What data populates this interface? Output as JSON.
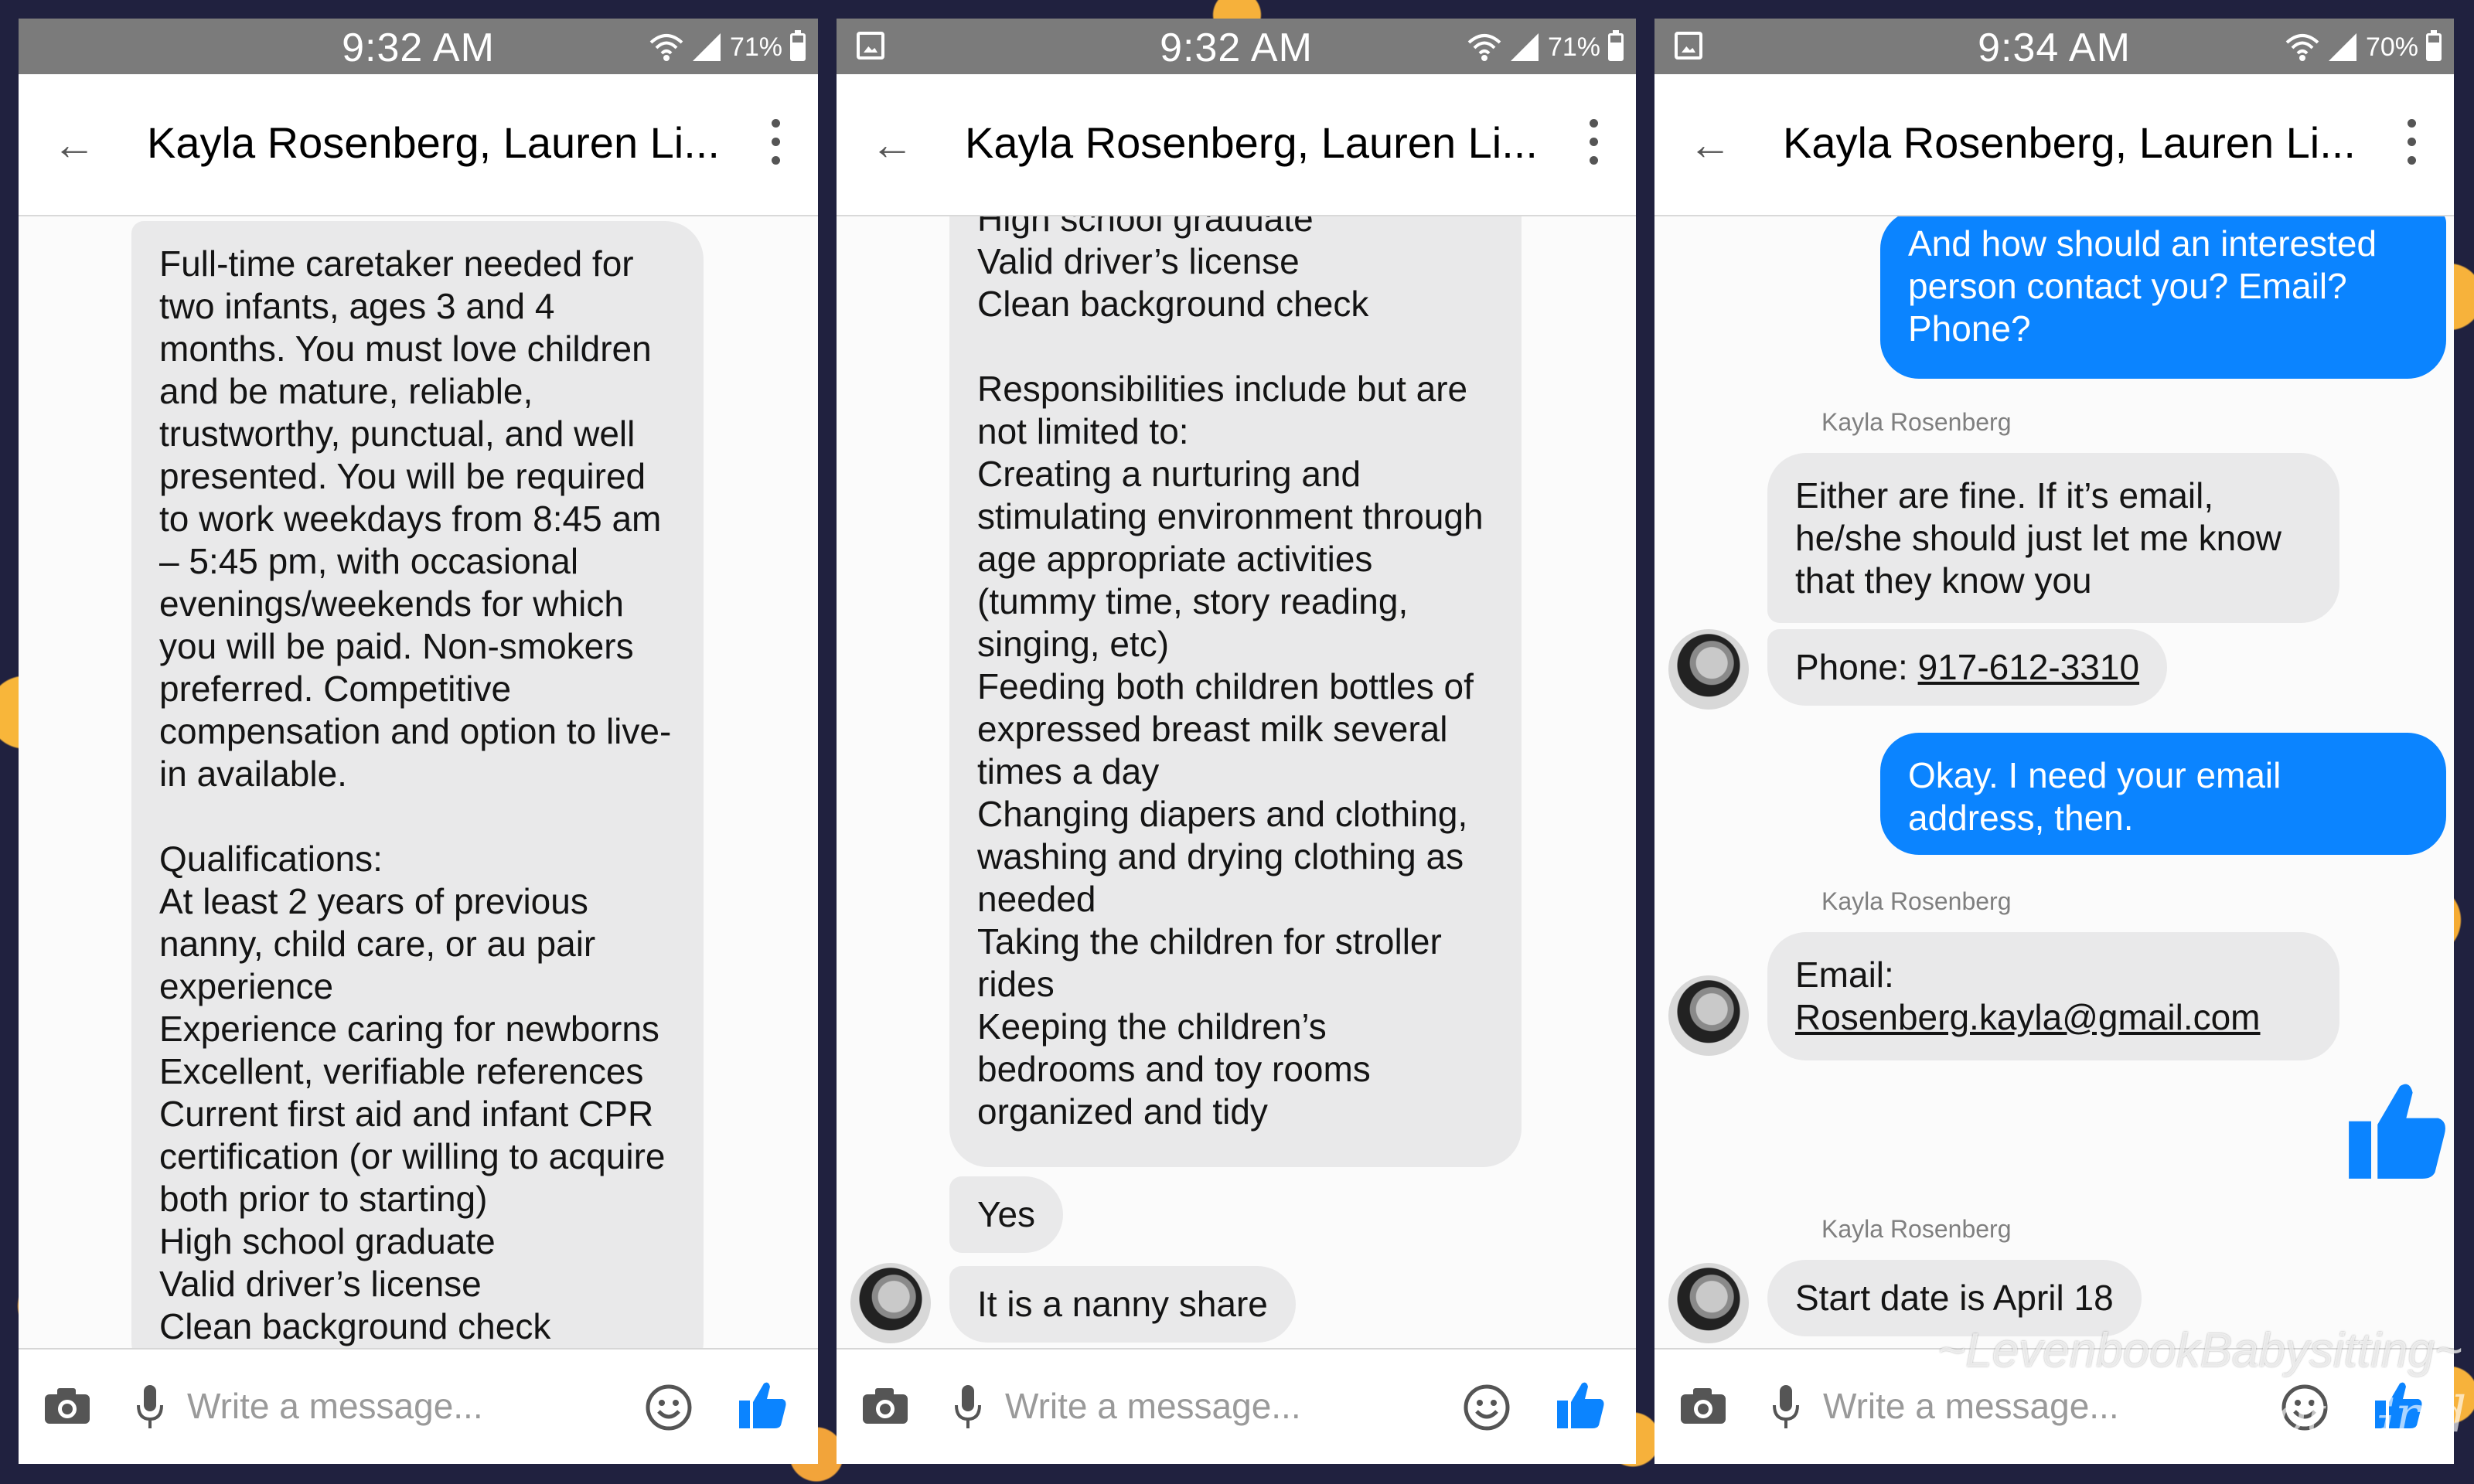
{
  "panels": [
    {
      "status": {
        "time": "9:32 AM",
        "battery": "71%"
      },
      "header": {
        "title": "Kayla Rosenberg, Lauren Li..."
      },
      "messages": {
        "job_post": "Full-time caretaker needed for two infants, ages 3 and 4 months. You must love children and be mature, reliable, trustworthy, punctual, and well presented. You will be required to work weekdays from 8:45 am – 5:45 pm, with occasional evenings/weekends for which you will be paid. Non-smokers preferred. Competitive compensation and option to live-in available.\n\nQualifications:\nAt least 2 years of previous nanny, child care, or au pair experience\nExperience caring for newborns\nExcellent, verifiable references\nCurrent first aid and infant CPR certification (or willing to acquire both prior to starting)\nHigh school graduate\nValid driver’s license\nClean background check"
      },
      "composer": {
        "placeholder": "Write a message..."
      }
    },
    {
      "status": {
        "time": "9:32 AM",
        "battery": "71%"
      },
      "header": {
        "title": "Kayla Rosenberg, Lauren Li..."
      },
      "messages": {
        "job_post_cont": "High school graduate\nValid driver’s license\nClean background check\n\nResponsibilities include but are not limited to:\nCreating a nurturing and stimulating environment through age appropriate activities (tummy time, story reading, singing, etc)\nFeeding both children bottles of expressed breast milk several times a day\nChanging diapers and clothing, washing and drying clothing as needed\nTaking the children for stroller rides\nKeeping the children’s bedrooms and toy rooms organized and tidy",
        "yes": "Yes",
        "nanny_share": "It is a nanny share"
      },
      "composer": {
        "placeholder": "Write a message..."
      }
    },
    {
      "status": {
        "time": "9:34 AM",
        "battery": "70%"
      },
      "header": {
        "title": "Kayla Rosenberg, Lauren Li..."
      },
      "messages": {
        "q_contact": "And how should an interested person contact you? Email? Phone?",
        "sender_1": "Kayla Rosenberg",
        "either_fine": "Either are fine. If it’s email, he/she should just let me know that they know you",
        "phone_label": "Phone: ",
        "phone_number": "917-612-3310",
        "need_email": "Okay. I need your email address, then.",
        "sender_2": "Kayla Rosenberg",
        "email_label": "Email:",
        "email_address": "Rosenberg.kayla@gmail.com",
        "sender_3": "Kayla Rosenberg",
        "start_date": "Start date is April 18"
      },
      "composer": {
        "placeholder": "Write a message..."
      }
    }
  ],
  "watermark": {
    "line1": "~LevenbookBabysitting~",
    "line2": "PhotoGrid"
  },
  "colors": {
    "accent": "#0b84ff",
    "statusbar": "#7b7b7b",
    "bubble": "#e9e9ea"
  }
}
